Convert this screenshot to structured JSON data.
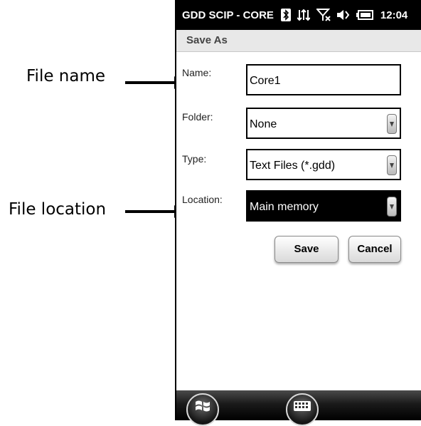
{
  "annotations": {
    "file_name_label": "File name",
    "file_location_label": "File location"
  },
  "device": {
    "status_bar": {
      "app_title": "GDD SCIP - CORE",
      "clock": "12:04",
      "icons": [
        "bluetooth-icon",
        "data-transfer-icon",
        "no-signal-icon",
        "volume-muted-icon",
        "battery-icon"
      ]
    },
    "screen_title": "Save As",
    "form": {
      "name": {
        "label": "Name:",
        "value": "Core1"
      },
      "folder": {
        "label": "Folder:",
        "value": "None"
      },
      "type": {
        "label": "Type:",
        "value": "Text Files (*.gdd)"
      },
      "location": {
        "label": "Location:",
        "value": "Main memory"
      }
    },
    "buttons": {
      "save": "Save",
      "cancel": "Cancel"
    },
    "taskbar": {
      "icons": [
        "windows-start-icon",
        "keyboard-icon"
      ]
    },
    "colors": {
      "status_bar": "#000000",
      "selected_field": "#000000",
      "title_strip": "#e8e8e8"
    }
  }
}
